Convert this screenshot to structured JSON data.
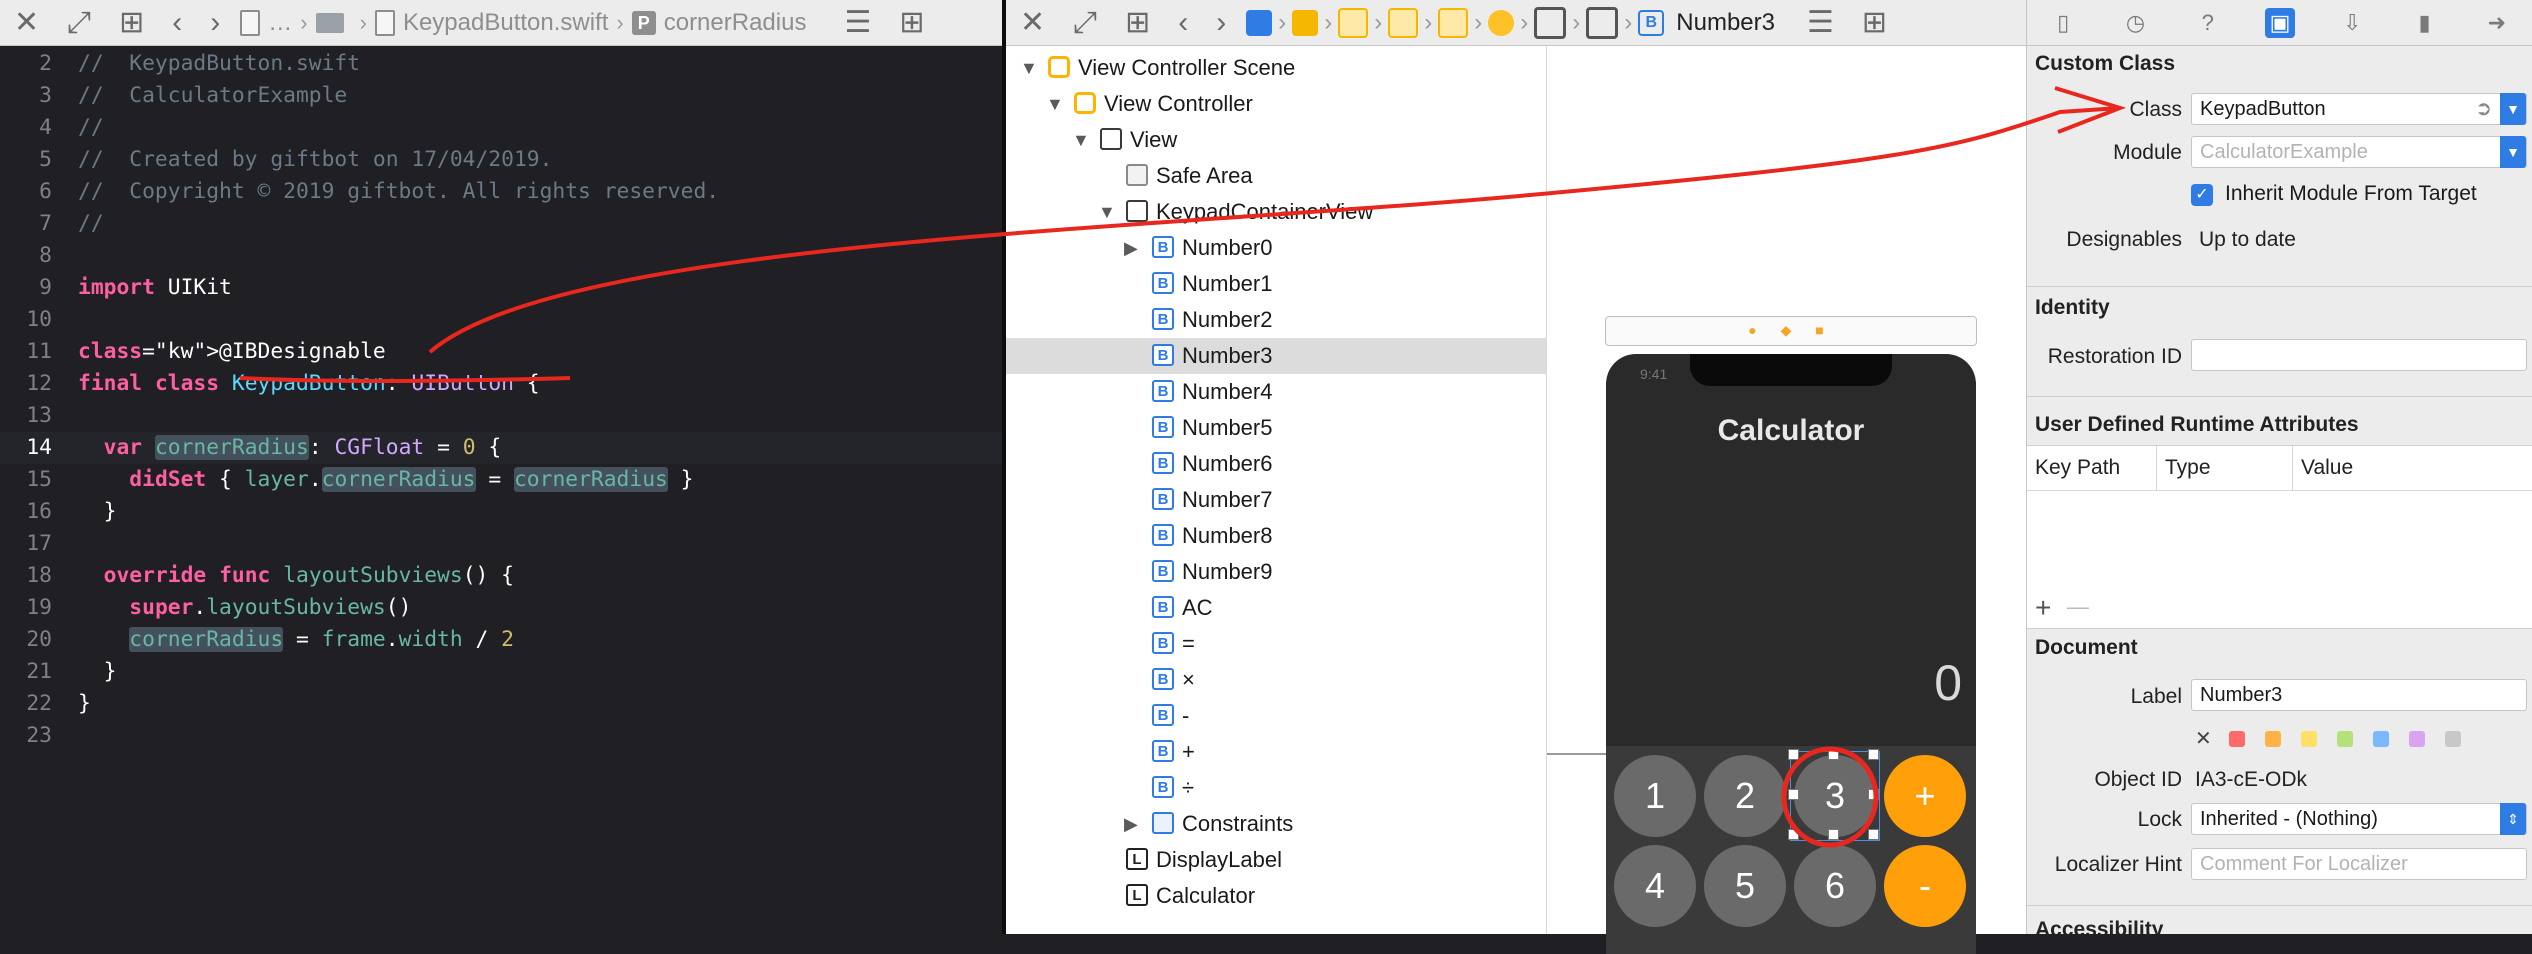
{
  "editor": {
    "breadcrumb": [
      "…",
      "KeypadButton.swift",
      "cornerRadius"
    ],
    "current_line": 14,
    "lines": [
      {
        "n": "2",
        "text": "//  KeypadButton.swift"
      },
      {
        "n": "3",
        "text": "//  CalculatorExample"
      },
      {
        "n": "4",
        "text": "//"
      },
      {
        "n": "5",
        "text": "//  Created by giftbot on 17/04/2019."
      },
      {
        "n": "6",
        "text": "//  Copyright © 2019 giftbot. All rights reserved."
      },
      {
        "n": "7",
        "text": "//"
      },
      {
        "n": "8",
        "text": ""
      },
      {
        "n": "9",
        "text": "import UIKit"
      },
      {
        "n": "10",
        "text": ""
      },
      {
        "n": "11",
        "text": "@IBDesignable"
      },
      {
        "n": "12",
        "text": "final class KeypadButton: UIButton {"
      },
      {
        "n": "13",
        "text": ""
      },
      {
        "n": "14",
        "text": "  var cornerRadius: CGFloat = 0 {"
      },
      {
        "n": "15",
        "text": "    didSet { layer.cornerRadius = cornerRadius }"
      },
      {
        "n": "16",
        "text": "  }"
      },
      {
        "n": "17",
        "text": ""
      },
      {
        "n": "18",
        "text": "  override func layoutSubviews() {"
      },
      {
        "n": "19",
        "text": "    super.layoutSubviews()"
      },
      {
        "n": "20",
        "text": "    cornerRadius = frame.width / 2"
      },
      {
        "n": "21",
        "text": "  }"
      },
      {
        "n": "22",
        "text": "}"
      },
      {
        "n": "23",
        "text": ""
      }
    ]
  },
  "ib": {
    "breadcrumb_last": "Number3",
    "outline": [
      {
        "label": "View Controller Scene",
        "icon": "scene-icon"
      },
      {
        "label": "View Controller",
        "icon": "view-controller-icon"
      },
      {
        "label": "View",
        "icon": "view-icon"
      },
      {
        "label": "Safe Area",
        "icon": "safe-area-icon"
      },
      {
        "label": "KeypadContainerView",
        "icon": "view-icon"
      },
      {
        "label": "Number0",
        "icon": "button-icon"
      },
      {
        "label": "Number1",
        "icon": "button-icon"
      },
      {
        "label": "Number2",
        "icon": "button-icon"
      },
      {
        "label": "Number3",
        "icon": "button-icon"
      },
      {
        "label": "Number4",
        "icon": "button-icon"
      },
      {
        "label": "Number5",
        "icon": "button-icon"
      },
      {
        "label": "Number6",
        "icon": "button-icon"
      },
      {
        "label": "Number7",
        "icon": "button-icon"
      },
      {
        "label": "Number8",
        "icon": "button-icon"
      },
      {
        "label": "Number9",
        "icon": "button-icon"
      },
      {
        "label": "AC",
        "icon": "button-icon"
      },
      {
        "label": "=",
        "icon": "button-icon"
      },
      {
        "label": "×",
        "icon": "button-icon"
      },
      {
        "label": "-",
        "icon": "button-icon"
      },
      {
        "label": "+",
        "icon": "button-icon"
      },
      {
        "label": "÷",
        "icon": "button-icon"
      },
      {
        "label": "Constraints",
        "icon": "constraints-icon"
      },
      {
        "label": "DisplayLabel",
        "icon": "label-icon"
      },
      {
        "label": "Calculator",
        "icon": "label-icon"
      }
    ],
    "icon_letters": {
      "button": "B",
      "label": "L"
    },
    "preview": {
      "status_time": "9:41",
      "title": "Calculator",
      "display_value": "0",
      "keys_row1": [
        "1",
        "2",
        "3",
        "+"
      ],
      "keys_row2": [
        "4",
        "5",
        "6",
        "-"
      ]
    }
  },
  "inspector": {
    "custom_class": {
      "header": "Custom Class",
      "class_label": "Class",
      "class_value": "KeypadButton",
      "module_label": "Module",
      "module_placeholder": "CalculatorExample",
      "inherit_label": "Inherit Module From Target",
      "inherit_checked": true,
      "designables_label": "Designables",
      "designables_value": "Up to date"
    },
    "identity": {
      "header": "Identity",
      "restoration_label": "Restoration ID",
      "restoration_value": ""
    },
    "udra": {
      "header": "User Defined Runtime Attributes",
      "columns": [
        "Key Path",
        "Type",
        "Value"
      ],
      "add_symbol": "+",
      "remove_symbol": "—"
    },
    "document": {
      "header": "Document",
      "label_label": "Label",
      "label_value": "Number3",
      "clear_symbol": "✕",
      "swatch_colors": [
        "#ff6b6b",
        "#ffb347",
        "#ffe066",
        "#b5e07a",
        "#7ab8ff",
        "#d9a3f0",
        "#c8c8c8"
      ],
      "object_id_label": "Object ID",
      "object_id_value": "IA3-cE-ODk",
      "lock_label": "Lock",
      "lock_value": "Inherited - (Nothing)",
      "localizer_label": "Localizer Hint",
      "localizer_placeholder": "Comment For Localizer"
    },
    "next_header": "Accessibility"
  },
  "colors": {
    "annotation": "#e8281e",
    "accent": "#2f7ce5",
    "operator_key": "#ff9f0a"
  }
}
